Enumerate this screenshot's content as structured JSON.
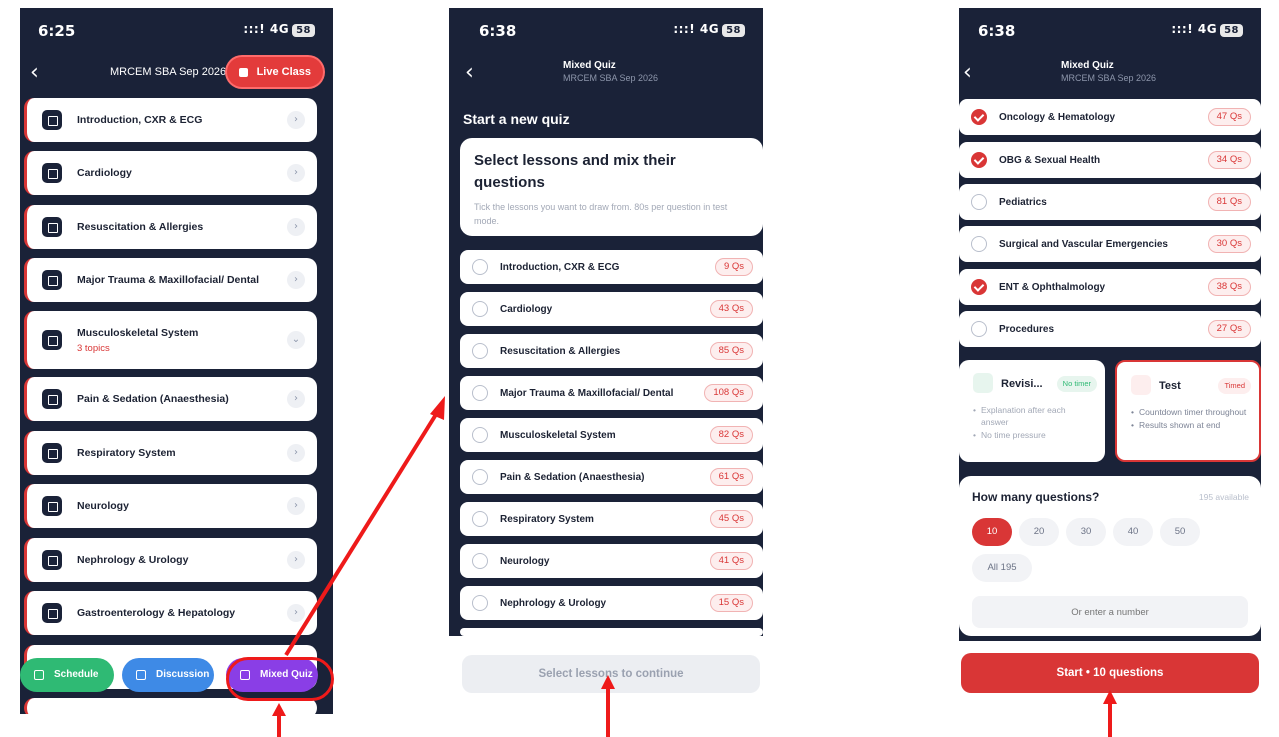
{
  "status_bar": {
    "p1_time": "6:25",
    "p2_time": "6:38",
    "p3_time": "6:38",
    "signal": ":::! 4G",
    "battery": "58"
  },
  "screen1": {
    "nav_title": "MRCEM SBA Sep 2026",
    "live_button": "Live Class",
    "lessons": [
      {
        "name": "Introduction, CXR & ECG"
      },
      {
        "name": "Cardiology"
      },
      {
        "name": "Resuscitation & Allergies"
      },
      {
        "name": "Major Trauma & Maxillofacial/ Dental"
      },
      {
        "name": "Musculoskeletal System",
        "sub": "3 topics"
      },
      {
        "name": "Pain & Sedation (Anaesthesia)"
      },
      {
        "name": "Respiratory System"
      },
      {
        "name": "Neurology"
      },
      {
        "name": "Nephrology & Urology"
      },
      {
        "name": "Gastroenterology & Hepatology"
      }
    ],
    "fabs": {
      "schedule": "Schedule",
      "discussion": "Discussion",
      "mixed_quiz": "Mixed Quiz"
    }
  },
  "screen2": {
    "nav_title": "Mixed Quiz",
    "nav_subtitle": "MRCEM SBA Sep 2026",
    "section_title": "Start a new quiz",
    "card_title": "Select lessons and mix their questions",
    "card_subtitle": "Tick the lessons you want to draw from. 80s per question in test mode.",
    "lessons": [
      {
        "name": "Introduction, CXR & ECG",
        "count": "9 Qs"
      },
      {
        "name": "Cardiology",
        "count": "43 Qs"
      },
      {
        "name": "Resuscitation & Allergies",
        "count": "85 Qs"
      },
      {
        "name": "Major Trauma & Maxillofacial/ Dental",
        "count": "108 Qs"
      },
      {
        "name": "Musculoskeletal System",
        "count": "82 Qs"
      },
      {
        "name": "Pain & Sedation (Anaesthesia)",
        "count": "61 Qs"
      },
      {
        "name": "Respiratory System",
        "count": "45 Qs"
      },
      {
        "name": "Neurology",
        "count": "41 Qs"
      },
      {
        "name": "Nephrology & Urology",
        "count": "15 Qs"
      }
    ],
    "cta": "Select lessons to continue"
  },
  "screen3": {
    "nav_title": "Mixed Quiz",
    "nav_subtitle": "MRCEM SBA Sep 2026",
    "lessons": [
      {
        "name": "Oncology & Hematology",
        "count": "47 Qs",
        "checked": true
      },
      {
        "name": "OBG & Sexual Health",
        "count": "34 Qs",
        "checked": true
      },
      {
        "name": "Pediatrics",
        "count": "81 Qs",
        "checked": false
      },
      {
        "name": "Surgical and Vascular Emergencies",
        "count": "30 Qs",
        "checked": false
      },
      {
        "name": "ENT & Ophthalmology",
        "count": "38 Qs",
        "checked": true
      },
      {
        "name": "Procedures",
        "count": "27 Qs",
        "checked": false
      }
    ],
    "revision": {
      "title": "Revisi...",
      "badge": "No timer",
      "bullets": [
        "Explanation after each answer",
        "No time pressure"
      ]
    },
    "test": {
      "title": "Test",
      "badge": "Timed",
      "bullets": [
        "Countdown timer throughout",
        "Results shown at end"
      ]
    },
    "questions_label": "How many questions?",
    "available": "195 available",
    "chips": [
      "10",
      "20",
      "30",
      "40",
      "50",
      "All 195"
    ],
    "selected_chip": "10",
    "number_placeholder": "Or enter a number",
    "cta": "Start  •  10 questions"
  },
  "colors": {
    "navy": "#1a2238",
    "accent_red": "#d93636",
    "annotation_red": "#ee1a1a",
    "purple": "#8a3ee6",
    "green": "#2fba74",
    "blue": "#3e8ae6"
  }
}
